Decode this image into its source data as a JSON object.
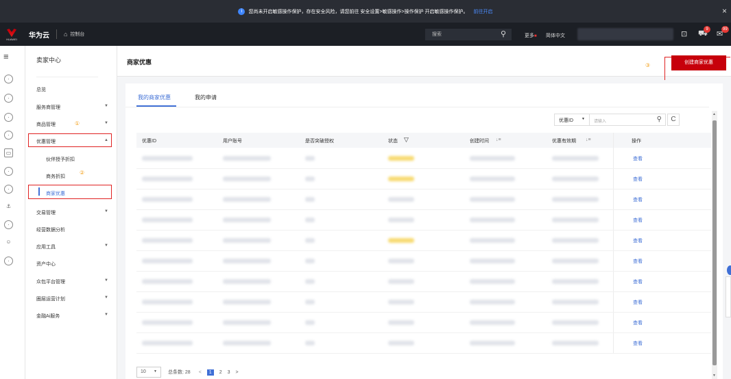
{
  "banner": {
    "text": "您尚未开启敏感操作保护，存在安全风险，请您前往 安全设置>敏感操作>操作保护 开启敏感操作保护。",
    "link": "前往开启",
    "close": "×"
  },
  "topbar": {
    "logo_text": "HUAWEI",
    "brand": "华为云",
    "console": "控制台",
    "search_placeholder": "搜索",
    "more": "更多",
    "lang": "简体中文",
    "badge_cart": "9",
    "badge_msg": "99"
  },
  "sidebar": {
    "title": "卖家中心",
    "items": [
      {
        "label": "总览",
        "chev": ""
      },
      {
        "label": "服务商管理",
        "chev": "▼"
      },
      {
        "label": "商品管理",
        "chev": "▼"
      },
      {
        "label": "优惠管理",
        "chev": "▲"
      },
      {
        "label": "交易管理",
        "chev": "▼"
      },
      {
        "label": "经营数据分析",
        "chev": ""
      },
      {
        "label": "应用工具",
        "chev": "▼"
      },
      {
        "label": "资产中心",
        "chev": ""
      },
      {
        "label": "众包平台管理",
        "chev": "▼"
      },
      {
        "label": "圈层运营计划",
        "chev": "▼"
      },
      {
        "label": "金融Ai服务",
        "chev": "▼"
      }
    ],
    "subitems": [
      "伙伴授予折扣",
      "商务折扣",
      "商家优惠"
    ]
  },
  "annotations": [
    "①",
    "②",
    "③"
  ],
  "page": {
    "title": "商家优惠",
    "create_button": "创建商家优惠"
  },
  "tabs": [
    "我的商家优惠",
    "我的申请"
  ],
  "filter": {
    "select": "优惠ID",
    "input_placeholder": "请输入",
    "refresh": "C"
  },
  "table": {
    "headers": [
      "优惠ID",
      "用户账号",
      "是否突破授权",
      "状态",
      "创建时间",
      "优惠有效期",
      "操作"
    ],
    "filter_icon": "▽",
    "sort_icon": "↓≡",
    "rows": [
      {
        "status_color": "yellow",
        "action": "查看"
      },
      {
        "status_color": "yellow",
        "action": "查看"
      },
      {
        "status_color": "gray",
        "action": "查看"
      },
      {
        "status_color": "gray",
        "action": "查看"
      },
      {
        "status_color": "yellow",
        "action": "查看"
      },
      {
        "status_color": "gray",
        "action": "查看"
      },
      {
        "status_color": "gray",
        "action": "查看"
      },
      {
        "status_color": "gray",
        "action": "查看"
      },
      {
        "status_color": "gray",
        "action": "查看"
      },
      {
        "status_color": "gray",
        "action": "查看"
      }
    ]
  },
  "pagination": {
    "page_size": "10",
    "total": "总条数: 28",
    "prev": "<",
    "pages": [
      "1",
      "2",
      "3"
    ],
    "next": ">"
  }
}
